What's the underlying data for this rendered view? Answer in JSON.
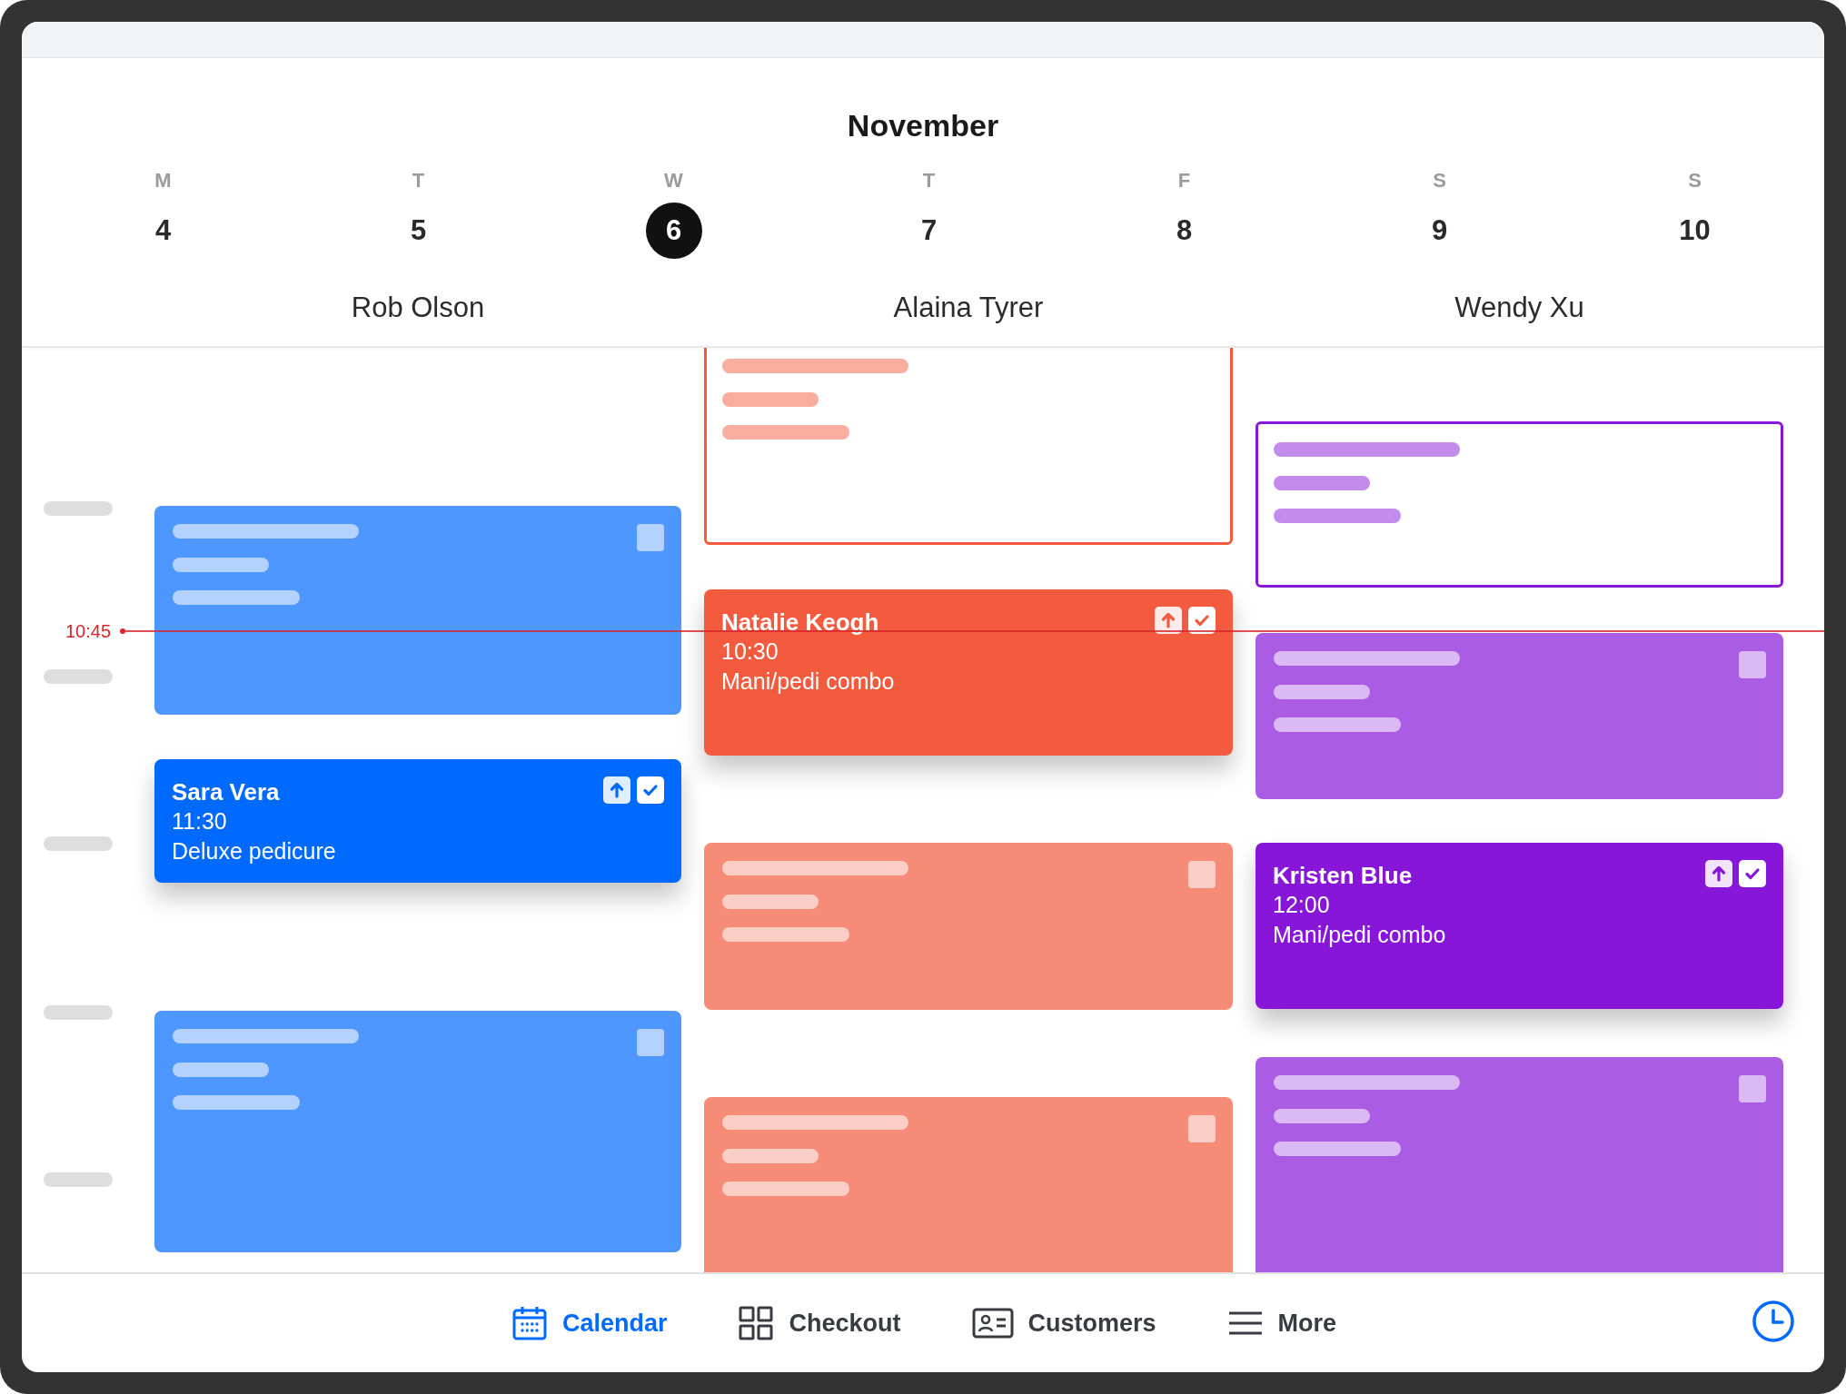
{
  "calendar": {
    "month": "November",
    "days": [
      {
        "letter": "M",
        "number": "4",
        "selected": false
      },
      {
        "letter": "T",
        "number": "5",
        "selected": false
      },
      {
        "letter": "W",
        "number": "6",
        "selected": true
      },
      {
        "letter": "T",
        "number": "7",
        "selected": false
      },
      {
        "letter": "F",
        "number": "8",
        "selected": false
      },
      {
        "letter": "S",
        "number": "9",
        "selected": false
      },
      {
        "letter": "S",
        "number": "10",
        "selected": false
      }
    ],
    "now_label": "10:45",
    "staff": [
      {
        "name": "Rob Olson",
        "color": "#006aff",
        "events": [
          {
            "kind": "placeholder"
          },
          {
            "kind": "appointment",
            "client": "Sara Vera",
            "time": "11:30",
            "service": "Deluxe pedicure"
          },
          {
            "kind": "placeholder"
          }
        ]
      },
      {
        "name": "Alaina Tyrer",
        "color": "#f25b3d",
        "events": [
          {
            "kind": "outline"
          },
          {
            "kind": "appointment",
            "client": "Natalie Keogh",
            "time": "10:30",
            "service": "Mani/pedi combo"
          },
          {
            "kind": "placeholder"
          },
          {
            "kind": "placeholder"
          }
        ]
      },
      {
        "name": "Wendy Xu",
        "color": "#8716d9",
        "events": [
          {
            "kind": "outline"
          },
          {
            "kind": "placeholder"
          },
          {
            "kind": "appointment",
            "client": "Kristen Blue",
            "time": "12:00",
            "service": "Mani/pedi combo"
          },
          {
            "kind": "placeholder"
          }
        ]
      }
    ]
  },
  "nav": [
    {
      "label": "Calendar",
      "selected": true
    },
    {
      "label": "Checkout",
      "selected": false
    },
    {
      "label": "Customers",
      "selected": false
    },
    {
      "label": "More",
      "selected": false
    }
  ]
}
